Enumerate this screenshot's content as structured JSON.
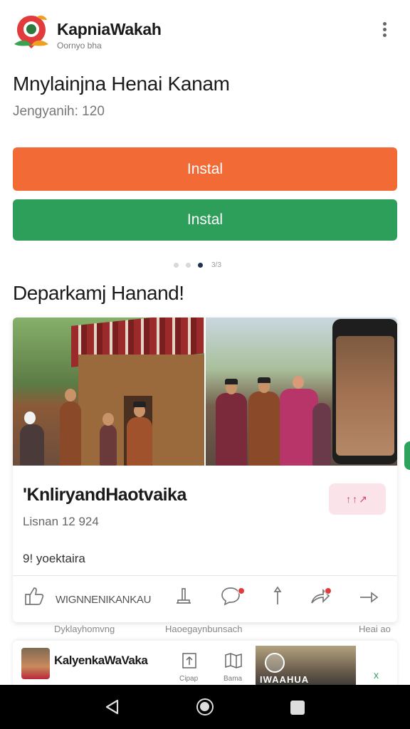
{
  "header": {
    "app_name": "KapniaWakah",
    "app_subtitle": "Oornyo bha",
    "logo": "app-logo-icon",
    "menu_icon": "more-vert-icon"
  },
  "hero": {
    "title": "Mnylainjna Henai Kanam",
    "subtitle": "Jengyanih: 120"
  },
  "buttons": {
    "primary_label": "Instal",
    "secondary_label": "Instal",
    "primary_color": "#f26a35",
    "secondary_color": "#2e9e5b"
  },
  "pager": {
    "count": 3,
    "active_index": 2,
    "label": "3/3"
  },
  "section": {
    "title": "Deparkamj Hanand!"
  },
  "post": {
    "title": "'KnliryandHaotvaika",
    "badge": "↑↑↗",
    "date": "Lisnan 12 924",
    "meta": "9! yoektaira",
    "actions": {
      "like_icon": "thumbs-up-icon",
      "like_label": "WIGNNENIKANKAU",
      "bookmark_icon": "stand-icon",
      "comment_icon": "comment-icon",
      "pin_icon": "pin-icon",
      "share_icon": "share-icon",
      "forward_icon": "forward-arrow-icon"
    }
  },
  "ghost_row": {
    "left": "Dyklayhomvng",
    "middle": "Haoegaynbunsach",
    "right": "Heai ao"
  },
  "next_post": {
    "title": "KalyenkaWaVaka",
    "icon1": "upload-icon",
    "icon1_label": "Cipap",
    "icon2": "map-icon",
    "icon2_label": "Bama",
    "thumb_text": "IWAAHUA",
    "close": "x"
  },
  "navbar": {
    "back": "nav-back-icon",
    "home": "nav-home-icon",
    "recent": "nav-recent-icon"
  }
}
